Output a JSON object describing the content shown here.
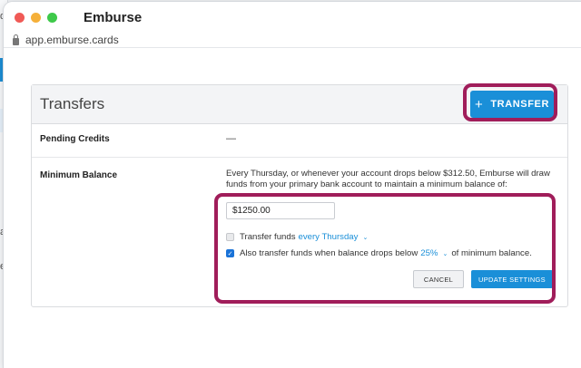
{
  "background": {
    "letters": [
      "d",
      "a",
      "e"
    ]
  },
  "window": {
    "title": "Emburse",
    "url": "app.emburse.cards"
  },
  "transfers": {
    "title": "Transfers",
    "transfer_button": {
      "icon": "plus-icon",
      "plus": "+",
      "label": "TRANSFER"
    }
  },
  "pending_credits": {
    "label": "Pending Credits",
    "value": "—"
  },
  "minimum_balance": {
    "label": "Minimum Balance",
    "description": "Every Thursday, or whenever your account drops below $312.50, Emburse will draw funds from your primary bank account to maintain a minimum balance of:",
    "amount_value": "$1250.00",
    "transfer_funds": {
      "checked": false,
      "label": "Transfer funds",
      "schedule": "every Thursday"
    },
    "also_transfer": {
      "checked": true,
      "label_before": "Also transfer funds when balance drops below",
      "percent": "25%",
      "label_after": "of minimum balance."
    },
    "cancel_label": "CANCEL",
    "update_label": "UPDATE SETTINGS"
  },
  "colors": {
    "accent": "#1a8fd8",
    "highlight": "#a01d5a",
    "checkbox": "#1a73d8"
  }
}
